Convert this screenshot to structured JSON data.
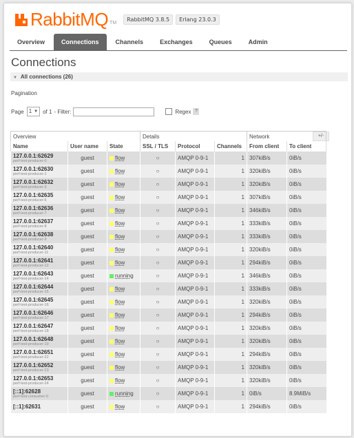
{
  "brand": {
    "name": "RabbitMQ",
    "tm": "TM",
    "color": "#ff6600"
  },
  "versions": [
    "RabbitMQ 3.8.5",
    "Erlang 23.0.3"
  ],
  "nav": [
    {
      "label": "Overview",
      "active": false
    },
    {
      "label": "Connections",
      "active": true
    },
    {
      "label": "Channels",
      "active": false
    },
    {
      "label": "Exchanges",
      "active": false
    },
    {
      "label": "Queues",
      "active": false
    },
    {
      "label": "Admin",
      "active": false
    }
  ],
  "page_title": "Connections",
  "section_title": "All connections (26)",
  "pagination": {
    "label": "Pagination",
    "page_label": "Page",
    "page_value": "1",
    "of_label": "of 1",
    "filter_label": "- Filter:",
    "filter_value": "",
    "regex_label": "Regex",
    "help": "?"
  },
  "table": {
    "groups": [
      "Overview",
      "Details",
      "Network"
    ],
    "toggle": "+/-",
    "columns": [
      "Name",
      "User name",
      "State",
      "SSL / TLS",
      "Protocol",
      "Channels",
      "From client",
      "To client"
    ],
    "state_colors": {
      "flow": "#ffff66",
      "running": "#66ee66"
    },
    "rows": [
      {
        "name": "127.0.0.1:62629",
        "sub": "perf-test-producer-0",
        "user": "guest",
        "state": "flow",
        "ssl": "○",
        "protocol": "AMQP 0-9-1",
        "channels": "1",
        "from": "307kiB/s",
        "to": "0iB/s"
      },
      {
        "name": "127.0.0.1:62630",
        "sub": "perf-test-producer-1",
        "user": "guest",
        "state": "flow",
        "ssl": "○",
        "protocol": "AMQP 0-9-1",
        "channels": "1",
        "from": "320kiB/s",
        "to": "0iB/s"
      },
      {
        "name": "127.0.0.1:62632",
        "sub": "perf-test-producer-3",
        "user": "guest",
        "state": "flow",
        "ssl": "○",
        "protocol": "AMQP 0-9-1",
        "channels": "1",
        "from": "320kiB/s",
        "to": "0iB/s"
      },
      {
        "name": "127.0.0.1:62635",
        "sub": "perf-test-producer-6",
        "user": "guest",
        "state": "flow",
        "ssl": "○",
        "protocol": "AMQP 0-9-1",
        "channels": "1",
        "from": "307kiB/s",
        "to": "0iB/s"
      },
      {
        "name": "127.0.0.1:62636",
        "sub": "perf-test-producer-7",
        "user": "guest",
        "state": "flow",
        "ssl": "○",
        "protocol": "AMQP 0-9-1",
        "channels": "1",
        "from": "346kiB/s",
        "to": "0iB/s"
      },
      {
        "name": "127.0.0.1:62637",
        "sub": "perf-test-producer-8",
        "user": "guest",
        "state": "flow",
        "ssl": "○",
        "protocol": "AMQP 0-9-1",
        "channels": "1",
        "from": "333kiB/s",
        "to": "0iB/s"
      },
      {
        "name": "127.0.0.1:62638",
        "sub": "perf-test-producer-9",
        "user": "guest",
        "state": "flow",
        "ssl": "○",
        "protocol": "AMQP 0-9-1",
        "channels": "1",
        "from": "333kiB/s",
        "to": "0iB/s"
      },
      {
        "name": "127.0.0.1:62640",
        "sub": "perf-test-producer-11",
        "user": "guest",
        "state": "flow",
        "ssl": "○",
        "protocol": "AMQP 0-9-1",
        "channels": "1",
        "from": "320kiB/s",
        "to": "0iB/s"
      },
      {
        "name": "127.0.0.1:62641",
        "sub": "perf-test-producer-12",
        "user": "guest",
        "state": "flow",
        "ssl": "○",
        "protocol": "AMQP 0-9-1",
        "channels": "1",
        "from": "294kiB/s",
        "to": "0iB/s"
      },
      {
        "name": "127.0.0.1:62643",
        "sub": "perf-test-producer-14",
        "user": "guest",
        "state": "running",
        "ssl": "○",
        "protocol": "AMQP 0-9-1",
        "channels": "1",
        "from": "346kiB/s",
        "to": "0iB/s"
      },
      {
        "name": "127.0.0.1:62644",
        "sub": "perf-test-producer-15",
        "user": "guest",
        "state": "flow",
        "ssl": "○",
        "protocol": "AMQP 0-9-1",
        "channels": "1",
        "from": "333kiB/s",
        "to": "0iB/s"
      },
      {
        "name": "127.0.0.1:62645",
        "sub": "perf-test-producer-16",
        "user": "guest",
        "state": "flow",
        "ssl": "○",
        "protocol": "AMQP 0-9-1",
        "channels": "1",
        "from": "320kiB/s",
        "to": "0iB/s"
      },
      {
        "name": "127.0.0.1:62646",
        "sub": "perf-test-producer-17",
        "user": "guest",
        "state": "flow",
        "ssl": "○",
        "protocol": "AMQP 0-9-1",
        "channels": "1",
        "from": "294kiB/s",
        "to": "0iB/s"
      },
      {
        "name": "127.0.0.1:62647",
        "sub": "perf-test-producer-18",
        "user": "guest",
        "state": "flow",
        "ssl": "○",
        "protocol": "AMQP 0-9-1",
        "channels": "1",
        "from": "320kiB/s",
        "to": "0iB/s"
      },
      {
        "name": "127.0.0.1:62648",
        "sub": "perf-test-producer-19",
        "user": "guest",
        "state": "flow",
        "ssl": "○",
        "protocol": "AMQP 0-9-1",
        "channels": "1",
        "from": "320kiB/s",
        "to": "0iB/s"
      },
      {
        "name": "127.0.0.1:62651",
        "sub": "perf-test-producer-22",
        "user": "guest",
        "state": "flow",
        "ssl": "○",
        "protocol": "AMQP 0-9-1",
        "channels": "1",
        "from": "294kiB/s",
        "to": "0iB/s"
      },
      {
        "name": "127.0.0.1:62652",
        "sub": "perf-test-producer-23",
        "user": "guest",
        "state": "flow",
        "ssl": "○",
        "protocol": "AMQP 0-9-1",
        "channels": "1",
        "from": "320kiB/s",
        "to": "0iB/s"
      },
      {
        "name": "127.0.0.1:62653",
        "sub": "perf-test-producer-24",
        "user": "guest",
        "state": "flow",
        "ssl": "○",
        "protocol": "AMQP 0-9-1",
        "channels": "1",
        "from": "320kiB/s",
        "to": "0iB/s"
      },
      {
        "name": "[::1]:62628",
        "sub": "perf-test-consumer-0",
        "user": "guest",
        "state": "running",
        "ssl": "○",
        "protocol": "AMQP 0-9-1",
        "channels": "1",
        "from": "0iB/s",
        "to": "8.9MiB/s"
      },
      {
        "name": "[::1]:62631",
        "sub": "",
        "user": "guest",
        "state": "flow",
        "ssl": "○",
        "protocol": "AMQP 0-9-1",
        "channels": "1",
        "from": "294kiB/s",
        "to": "0iB/s"
      }
    ]
  }
}
